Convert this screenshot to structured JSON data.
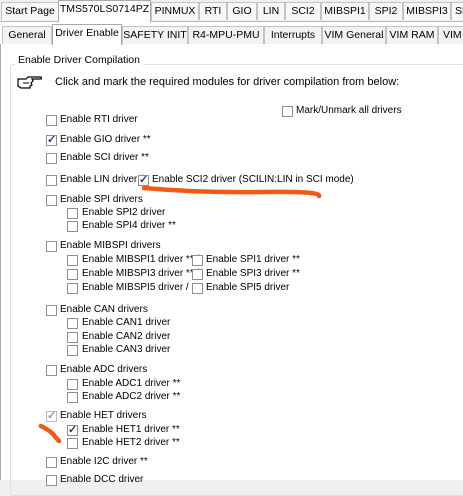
{
  "top_tabs": [
    "Start Page",
    "TMS570LS0714PZ",
    "PINMUX",
    "RTI",
    "GIO",
    "LIN",
    "SCI2",
    "MIBSPI1",
    "SPI2",
    "MIBSPI3",
    "SPI"
  ],
  "sub_tabs": [
    "General",
    "Driver Enable",
    "SAFETY INIT",
    "R4-MPU-PMU",
    "Interrupts",
    "VIM General",
    "VIM RAM",
    "VIM"
  ],
  "group_title": "Enable Driver Compilation",
  "instruction": "Click and mark the required modules for driver compilation from below:",
  "mark_all": {
    "label": "Mark/Unmark all drivers",
    "checked": false
  },
  "drivers": {
    "rti": {
      "label": "Enable RTI driver",
      "checked": false
    },
    "gio": {
      "label": "Enable GIO driver **",
      "checked": true
    },
    "sci": {
      "label": "Enable SCI driver **",
      "checked": false
    },
    "lin": {
      "label": "Enable LIN driver /",
      "checked": false
    },
    "sci2": {
      "label": "Enable SCI2 driver (SCILIN:LIN in SCI mode)",
      "checked": true
    },
    "spi": {
      "label": "Enable SPI drivers",
      "checked": false
    },
    "spi2": {
      "label": "Enable SPI2 driver",
      "checked": false
    },
    "spi4": {
      "label": "Enable SPI4 driver **",
      "checked": false
    },
    "mibspi": {
      "label": "Enable MIBSPI drivers",
      "checked": false
    },
    "mibspi1": {
      "label": "Enable MIBSPI1 driver ** /",
      "checked": false
    },
    "spi1": {
      "label": "Enable SPI1 driver **",
      "checked": false
    },
    "mibspi3": {
      "label": "Enable MIBSPI3 driver ** /",
      "checked": false
    },
    "spi3": {
      "label": "Enable SPI3 driver **",
      "checked": false
    },
    "mibspi5": {
      "label": "Enable MIBSPI5 driver /",
      "checked": false
    },
    "spi5": {
      "label": "Enable SPI5 driver",
      "checked": false
    },
    "can": {
      "label": "Enable CAN drivers",
      "checked": false
    },
    "can1": {
      "label": "Enable CAN1 driver",
      "checked": false
    },
    "can2": {
      "label": "Enable CAN2 driver",
      "checked": false
    },
    "can3": {
      "label": "Enable CAN3 driver",
      "checked": false
    },
    "adc": {
      "label": "Enable ADC drivers",
      "checked": false
    },
    "adc1": {
      "label": "Enable ADC1 driver **",
      "checked": false
    },
    "adc2": {
      "label": "Enable ADC2 driver **",
      "checked": false
    },
    "het": {
      "label": "Enable HET drivers",
      "checked": true
    },
    "het1": {
      "label": "Enable HET1 driver **",
      "checked": true
    },
    "het2": {
      "label": "Enable HET2 driver **",
      "checked": false
    },
    "i2c": {
      "label": "Enable I2C driver **",
      "checked": false
    },
    "dcc": {
      "label": "Enable DCC driver",
      "checked": false
    }
  },
  "colors": {
    "annotation": "#f25a12",
    "check": "#1f3d7a",
    "tab_border": "#a9a9a9"
  },
  "icons": {
    "instruction": "pointing-hand-icon"
  }
}
